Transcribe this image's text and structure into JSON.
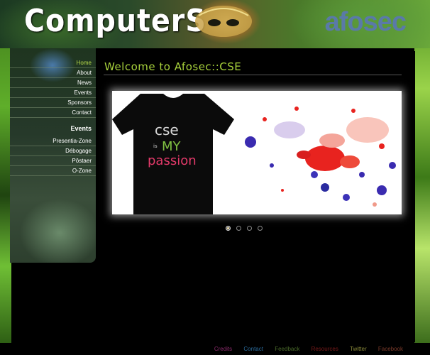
{
  "header": {
    "title": "ComputerS",
    "brand": "afosec"
  },
  "sidebar": {
    "items": [
      {
        "label": "Home",
        "active": true
      },
      {
        "label": "About"
      },
      {
        "label": "News"
      },
      {
        "label": "Events"
      },
      {
        "label": "Sponsors"
      },
      {
        "label": "Contact"
      }
    ],
    "events_heading": "Events",
    "event_items": [
      {
        "label": "Presentia-Zone"
      },
      {
        "label": "Débogage"
      },
      {
        "label": "Pôstaer"
      },
      {
        "label": "O-Zone"
      }
    ]
  },
  "main": {
    "page_title": "Welcome to Afosec::CSE",
    "slide": {
      "shirt_text_1": "cse",
      "shirt_text_2": "is",
      "shirt_text_3": "MY",
      "shirt_text_4": "passion"
    },
    "slider": {
      "count": 4,
      "active_index": 0
    }
  },
  "footer": {
    "links": [
      {
        "label": "Credits",
        "color": "#8a2a6a"
      },
      {
        "label": "Contact",
        "color": "#2a6a9a"
      },
      {
        "label": "Feedback",
        "color": "#4a6a2a"
      },
      {
        "label": "Resources",
        "color": "#7a1a1a"
      },
      {
        "label": "Twitter",
        "color": "#8a8a3a"
      },
      {
        "label": "Facebook",
        "color": "#7a3a2a"
      }
    ]
  },
  "colors": {
    "accent": "#a8d23c",
    "nav_active": "#b7dc4a",
    "brand": "#5a7aa8"
  }
}
